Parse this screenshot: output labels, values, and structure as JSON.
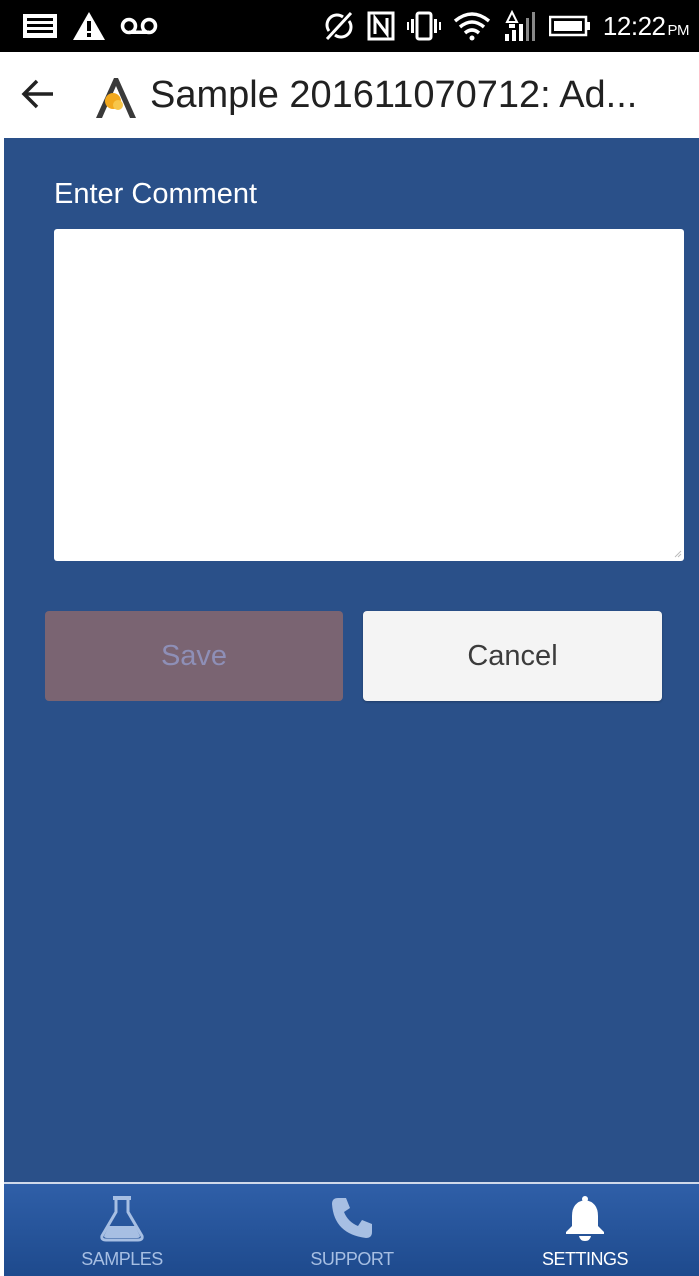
{
  "status_bar": {
    "time": "12:22",
    "ampm": "PM",
    "icons": [
      "notification-image-icon",
      "warning-icon",
      "voicemail-icon",
      "sync-off-icon",
      "nfc-icon",
      "vibrate-icon",
      "wifi-icon",
      "signal-icon",
      "battery-icon"
    ]
  },
  "app_bar": {
    "title": "Sample 201611070712: Ad..."
  },
  "form": {
    "label": "Enter Comment",
    "comment_value": "",
    "save_label": "Save",
    "cancel_label": "Cancel"
  },
  "bottom_nav": {
    "items": [
      {
        "label": "SAMPLES",
        "icon": "flask-icon",
        "active": false
      },
      {
        "label": "SUPPORT",
        "icon": "phone-icon",
        "active": false
      },
      {
        "label": "SETTINGS",
        "icon": "bell-icon",
        "active": true
      }
    ]
  },
  "colors": {
    "content_bg": "#2a5089",
    "save_button_bg": "#7a6472",
    "save_button_text": "#8e8fb7",
    "cancel_button_bg": "#f4f4f4",
    "nav_active": "#ffffff",
    "nav_inactive": "#a7bfe3"
  }
}
